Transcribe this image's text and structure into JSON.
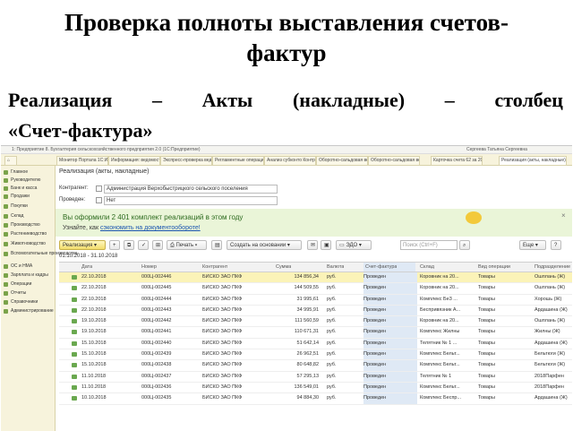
{
  "slide": {
    "title_line1": "Проверка полноты выставления счетов-",
    "title_line2": "фактур",
    "subtitle_line1_words": [
      "Реализация",
      "–",
      "Акты",
      "(накладные)",
      "–",
      "столбец"
    ],
    "subtitle_line2": "«Счет-фактура»"
  },
  "window": {
    "title": "1: Предприятие 8. Бухгалтерия сельскохозяйственного предприятия 2.0 (1С:Предприятие)",
    "user": "Сергеева Татьяна Сергеевна"
  },
  "tabs": [
    "Начальная страница",
    "Монитор Портала 1С:ИТС",
    "Информация: ведомость 1С",
    "Экспресс-проверка ведения...",
    "Регламентные операции И...",
    "Анализ субконто Контрагенты",
    "Оборотно-сальдовая ведом...",
    "Карточка счета 62 за 2018...",
    "Реализация (акты, накладные)"
  ],
  "sidebar": [
    "Главное",
    "Руководителю",
    "Банк и касса",
    "Продажи",
    "Покупки",
    "Склад",
    "Производство",
    "Растениеводство",
    "Животноводство",
    "Вспомогательные производства",
    "ОС и НМА",
    "Зарплата и кадры",
    "Операции",
    "Отчеты",
    "Справочники",
    "Администрирование"
  ],
  "form": {
    "title": "Реализация (акты, накладные)",
    "contractor_label": "Контрагент:",
    "contractor_value": "Администрация Верхобыстрицкого сельского поселения",
    "posted_label": "Проведен:",
    "posted_value": "Нет"
  },
  "banner": {
    "headline": "Вы оформили 2 401 комплект реализаций в этом году",
    "link_prefix": "Узнайте, как",
    "link_text": "сэкономить на документообороте!",
    "close": "×"
  },
  "toolbar": {
    "realization": "Реализация",
    "print": "Печать",
    "create_based": "Создать на основании",
    "edo": "ЭДО",
    "search_placeholder": "Поиск (Ctrl+F)",
    "more": "Еще",
    "help": "?"
  },
  "period": "01.10.2018 - 31.10.2018",
  "table": {
    "headers": [
      "Дата",
      "Номер",
      "Контрагент",
      "Сумма",
      "Валюта",
      "Счет-фактура",
      "Склад",
      "Вид операции",
      "Подразделение"
    ],
    "rows": [
      [
        "22.10.2018",
        "000Ц-002446",
        "БИСКО ЗАО ПКФ",
        "134 856,34",
        "руб.",
        "Проведен",
        "Коровник на 20...",
        "Товары",
        "Ошплань (Ж)"
      ],
      [
        "22.10.2018",
        "000Ц-002445",
        "БИСКО ЗАО ПКФ",
        "144 509,55",
        "руб.",
        "Проведен",
        "Коровник на 20...",
        "Товары",
        "Ошплань (Ж)"
      ],
      [
        "22.10.2018",
        "000Ц-002444",
        "БИСКО ЗАО ПКФ",
        "31 995,61",
        "руб.",
        "Проведен",
        "Комплекс Бе3 ...",
        "Товары",
        "Хорошь (Ж)"
      ],
      [
        "22.10.2018",
        "000Ц-002443",
        "БИСКО ЗАО ПКФ",
        "34 995,91",
        "руб.",
        "Проведен",
        "Беспривязник А...",
        "Товары",
        "Ардашина (Ж)"
      ],
      [
        "19.10.2018",
        "000Ц-002442",
        "БИСКО ЗАО ПКФ",
        "111 560,59",
        "руб.",
        "Проведен",
        "Коровник на 20...",
        "Товары",
        "Ошплань (Ж)"
      ],
      [
        "19.10.2018",
        "000Ц-002441",
        "БИСКО ЗАО ПКФ",
        "110 671,31",
        "руб.",
        "Проведен",
        "Комплекс Жилны",
        "Товары",
        "Жилны (Ж)"
      ],
      [
        "15.10.2018",
        "000Ц-002440",
        "БИСКО ЗАО ПКФ",
        "51 642,14",
        "руб.",
        "Проведен",
        "Телятник № 1 ...",
        "Товары",
        "Ардашина (Ж)"
      ],
      [
        "15.10.2018",
        "000Ц-002439",
        "БИСКО ЗАО ПКФ",
        "26 962,51",
        "руб.",
        "Проведен",
        "Комплекс Бельт...",
        "Товары",
        "Бельтюги (Ж)"
      ],
      [
        "15.10.2018",
        "000Ц-002438",
        "БИСКО ЗАО ПКФ",
        "80 648,82",
        "руб.",
        "Проведен",
        "Комплекс Бельт...",
        "Товары",
        "Бельтюги (Ж)"
      ],
      [
        "11.10.2018",
        "000Ц-002437",
        "БИСКО ЗАО ПКФ",
        "57 295,13",
        "руб.",
        "Проведен",
        "Телятник № 1",
        "Товары",
        "2018Парфен"
      ],
      [
        "11.10.2018",
        "000Ц-002436",
        "БИСКО ЗАО ПКФ",
        "136 549,01",
        "руб.",
        "Проведен",
        "Комплекс Бельт...",
        "Товары",
        "2018Парфен"
      ],
      [
        "10.10.2018",
        "000Ц-002435",
        "БИСКО ЗАО ПКФ",
        "94 884,30",
        "руб.",
        "Проведен",
        "Комплекс Беспр...",
        "Товары",
        "Ардашина (Ж)"
      ]
    ]
  },
  "colors": {
    "banner_bg": "#eaf5d8",
    "banner_text": "#2d6b1f",
    "selected_row": "#fbf3b8",
    "invoice_column": "#dfe9f5",
    "panel_bg": "#f7f3dc"
  }
}
